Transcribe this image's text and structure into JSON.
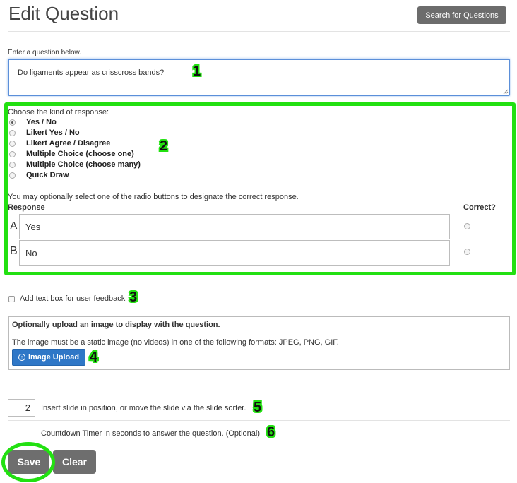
{
  "page_title": "Edit Question",
  "search_button_label": "Search for Questions",
  "question": {
    "label": "Enter a question below.",
    "value": "Do ligaments appear as crisscross bands?"
  },
  "response_kind": {
    "label": "Choose the kind of response:",
    "selected": "Yes / No",
    "options": [
      "Yes / No",
      "Likert Yes / No",
      "Likert Agree / Disagree",
      "Multiple Choice (choose one)",
      "Multiple Choice (choose many)",
      "Quick Draw"
    ]
  },
  "responses": {
    "hint": "You may optionally select one of the radio buttons to designate the correct response.",
    "response_header": "Response",
    "correct_header": "Correct?",
    "rows": [
      {
        "letter": "A",
        "value": "Yes"
      },
      {
        "letter": "B",
        "value": "No"
      }
    ]
  },
  "feedback_checkbox_label": "Add text box for user feedback",
  "image_panel": {
    "heading": "Optionally upload an image to display with the question.",
    "note": "The image must be a static image (no videos) in one of the following formats: JPEG, PNG, GIF.",
    "upload_button_label": "Image Upload",
    "upload_icon_glyph": "↑"
  },
  "slide_position": {
    "value": "2",
    "label": "Insert slide in position, or move the slide via the slide sorter."
  },
  "countdown": {
    "value": "",
    "label": "Countdown Timer in seconds to answer the question. (Optional)"
  },
  "buttons": {
    "save": "Save",
    "clear": "Clear"
  },
  "annotations": [
    "1",
    "2",
    "3",
    "4",
    "5",
    "6"
  ],
  "colors": {
    "highlight": "#22e011",
    "primary": "#2f77c7",
    "button_gray": "#6e6e6e"
  }
}
